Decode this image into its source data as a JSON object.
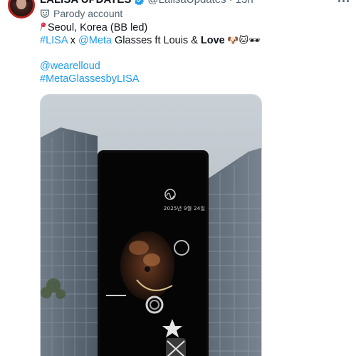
{
  "header": {
    "display_name": "LALISA UPDATES",
    "handle": "@LalisaUpdates",
    "separator": "·",
    "time": "13h"
  },
  "account_label": {
    "text": "Parody account",
    "icon": "parody-mask-icon"
  },
  "tweet": {
    "line1_text": "Seoul, Korea (BB led)",
    "line2": {
      "hashtag_lisa": "#LISA",
      "x_text": " x ",
      "mention_meta": "@Meta",
      "glasses_text": " Glasses ft Louis & ",
      "love_text": "Love",
      "emojis": " 🐶🐱🕶"
    },
    "mention_wearelloud": "@wearelloud",
    "hashtag_metaglasses": "#MetaGlassesbyLISA"
  },
  "media": {
    "screen_date": "2025년 9월 24일",
    "description_icon": "billboard-video"
  },
  "colors": {
    "link": "#1d9bf0",
    "verified": "#1d9bf0",
    "secondary_text": "#536471",
    "avatar_ring": "#b3261e"
  }
}
